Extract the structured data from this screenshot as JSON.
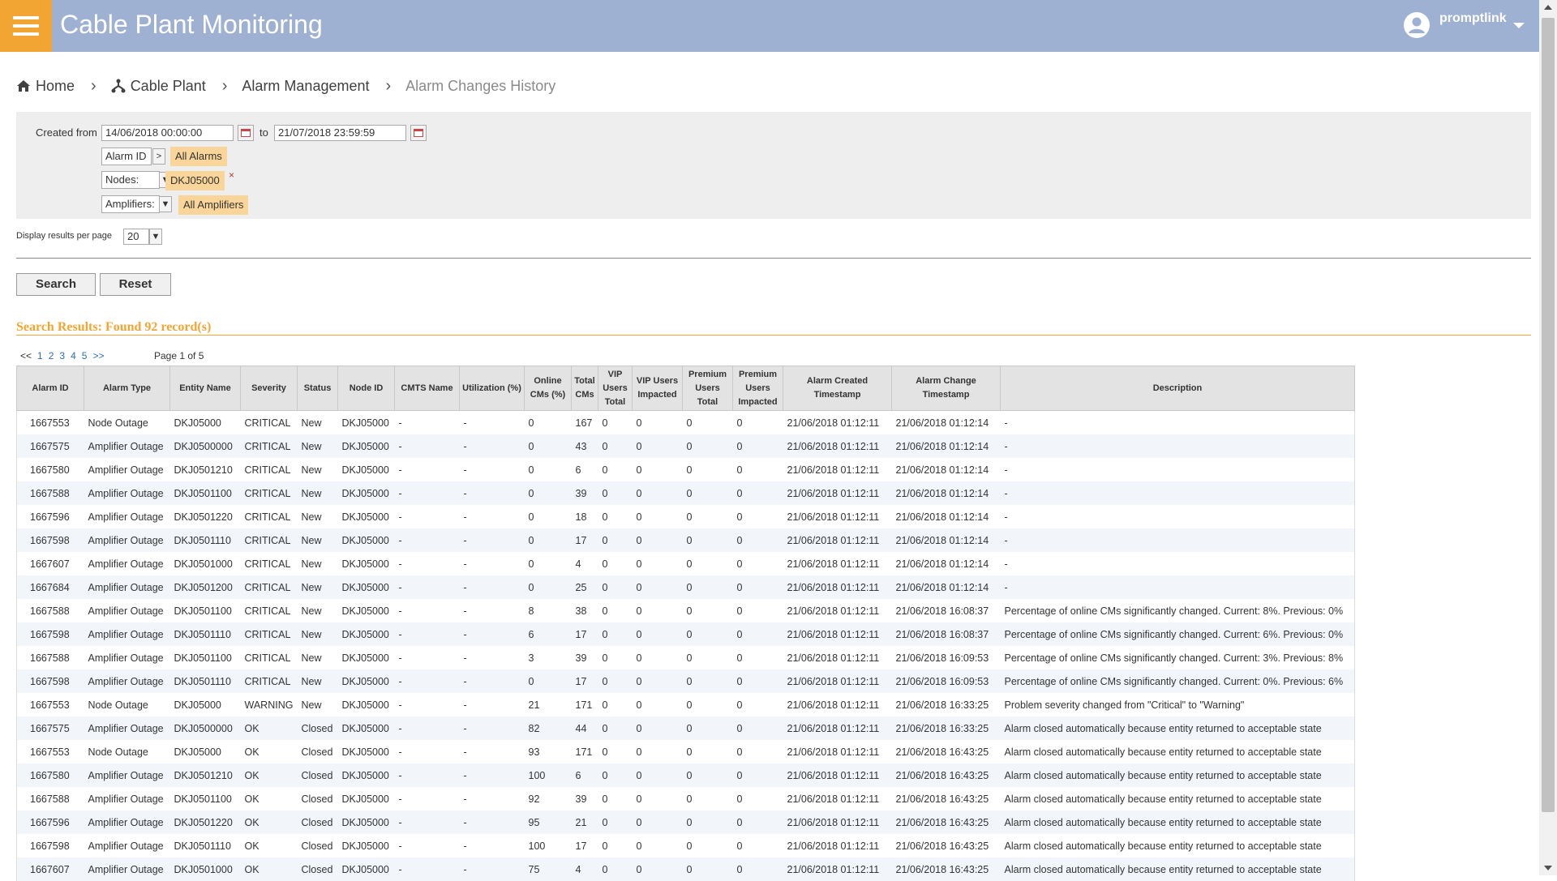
{
  "header": {
    "title": "Cable Plant Monitoring",
    "user": "promptlink"
  },
  "breadcrumb": [
    "Home",
    "Cable Plant",
    "Alarm Management",
    "Alarm Changes History"
  ],
  "filters": {
    "created_from_label": "Created from",
    "from_value": "14/06/2018 00:00:00",
    "to_label": "to",
    "to_value": "21/07/2018 23:59:59",
    "alarm_id_label": "Alarm ID",
    "alarm_id_arrow": ">",
    "alarm_id_tag": "All Alarms",
    "nodes_label": "Nodes:",
    "nodes_tag": "DKJ05000",
    "amplifiers_label": "Amplifiers:",
    "amplifiers_tag": "All Amplifiers",
    "dropdown_arrow": "▼",
    "remove_glyph": "×"
  },
  "per_page": {
    "label": "Display results per page",
    "value": "20"
  },
  "buttons": {
    "search": "Search",
    "reset": "Reset"
  },
  "results": {
    "title": "Search Results: Found 92 record(s)"
  },
  "pager": {
    "first": "<<",
    "pages": [
      "1",
      "2",
      "3",
      "4",
      "5"
    ],
    "last": ">>",
    "info": "Page 1 of 5"
  },
  "colors": {
    "header_bg": "#9fb1d3",
    "accent": "#f3a533",
    "critical": "#e53935",
    "warning": "#f3a533",
    "ok": "#43a047"
  },
  "icons": {
    "menu": "hamburger-icon",
    "user": "user-avatar-icon",
    "home": "home-icon",
    "cable_plant": "hierarchy-icon",
    "calendar": "calendar-icon"
  },
  "table": {
    "columns": [
      "Alarm ID",
      "Alarm Type",
      "Entity Name",
      "Severity",
      "Status",
      "Node ID",
      "CMTS Name",
      "Utilization (%)",
      "Online CMs (%)",
      "Total CMs",
      "VIP Users Total",
      "VIP Users Impacted",
      "Premium Users Total",
      "Premium Users Impacted",
      "Alarm Created Timestamp",
      "Alarm Change Timestamp",
      "Description"
    ],
    "rows": [
      [
        "1667553",
        "Node Outage",
        "DKJ05000",
        "CRITICAL",
        "New",
        "DKJ05000",
        "-",
        "-",
        "0",
        "167",
        "0",
        "0",
        "0",
        "0",
        "21/06/2018 01:12:11",
        "21/06/2018 01:12:14",
        "-"
      ],
      [
        "1667575",
        "Amplifier Outage",
        "DKJ0500000",
        "CRITICAL",
        "New",
        "DKJ05000",
        "-",
        "-",
        "0",
        "43",
        "0",
        "0",
        "0",
        "0",
        "21/06/2018 01:12:11",
        "21/06/2018 01:12:14",
        "-"
      ],
      [
        "1667580",
        "Amplifier Outage",
        "DKJ0501210",
        "CRITICAL",
        "New",
        "DKJ05000",
        "-",
        "-",
        "0",
        "6",
        "0",
        "0",
        "0",
        "0",
        "21/06/2018 01:12:11",
        "21/06/2018 01:12:14",
        "-"
      ],
      [
        "1667588",
        "Amplifier Outage",
        "DKJ0501100",
        "CRITICAL",
        "New",
        "DKJ05000",
        "-",
        "-",
        "0",
        "39",
        "0",
        "0",
        "0",
        "0",
        "21/06/2018 01:12:11",
        "21/06/2018 01:12:14",
        "-"
      ],
      [
        "1667596",
        "Amplifier Outage",
        "DKJ0501220",
        "CRITICAL",
        "New",
        "DKJ05000",
        "-",
        "-",
        "0",
        "18",
        "0",
        "0",
        "0",
        "0",
        "21/06/2018 01:12:11",
        "21/06/2018 01:12:14",
        "-"
      ],
      [
        "1667598",
        "Amplifier Outage",
        "DKJ0501110",
        "CRITICAL",
        "New",
        "DKJ05000",
        "-",
        "-",
        "0",
        "17",
        "0",
        "0",
        "0",
        "0",
        "21/06/2018 01:12:11",
        "21/06/2018 01:12:14",
        "-"
      ],
      [
        "1667607",
        "Amplifier Outage",
        "DKJ0501000",
        "CRITICAL",
        "New",
        "DKJ05000",
        "-",
        "-",
        "0",
        "4",
        "0",
        "0",
        "0",
        "0",
        "21/06/2018 01:12:11",
        "21/06/2018 01:12:14",
        "-"
      ],
      [
        "1667684",
        "Amplifier Outage",
        "DKJ0501200",
        "CRITICAL",
        "New",
        "DKJ05000",
        "-",
        "-",
        "0",
        "25",
        "0",
        "0",
        "0",
        "0",
        "21/06/2018 01:12:11",
        "21/06/2018 01:12:14",
        "-"
      ],
      [
        "1667588",
        "Amplifier Outage",
        "DKJ0501100",
        "CRITICAL",
        "New",
        "DKJ05000",
        "-",
        "-",
        "8",
        "38",
        "0",
        "0",
        "0",
        "0",
        "21/06/2018 01:12:11",
        "21/06/2018 16:08:37",
        "Percentage of online CMs significantly changed. Current: 8%. Previous: 0%"
      ],
      [
        "1667598",
        "Amplifier Outage",
        "DKJ0501110",
        "CRITICAL",
        "New",
        "DKJ05000",
        "-",
        "-",
        "6",
        "17",
        "0",
        "0",
        "0",
        "0",
        "21/06/2018 01:12:11",
        "21/06/2018 16:08:37",
        "Percentage of online CMs significantly changed. Current: 6%. Previous: 0%"
      ],
      [
        "1667588",
        "Amplifier Outage",
        "DKJ0501100",
        "CRITICAL",
        "New",
        "DKJ05000",
        "-",
        "-",
        "3",
        "39",
        "0",
        "0",
        "0",
        "0",
        "21/06/2018 01:12:11",
        "21/06/2018 16:09:53",
        "Percentage of online CMs significantly changed. Current: 3%. Previous: 8%"
      ],
      [
        "1667598",
        "Amplifier Outage",
        "DKJ0501110",
        "CRITICAL",
        "New",
        "DKJ05000",
        "-",
        "-",
        "0",
        "17",
        "0",
        "0",
        "0",
        "0",
        "21/06/2018 01:12:11",
        "21/06/2018 16:09:53",
        "Percentage of online CMs significantly changed. Current: 0%. Previous: 6%"
      ],
      [
        "1667553",
        "Node Outage",
        "DKJ05000",
        "WARNING",
        "New",
        "DKJ05000",
        "-",
        "-",
        "21",
        "171",
        "0",
        "0",
        "0",
        "0",
        "21/06/2018 01:12:11",
        "21/06/2018 16:33:25",
        "Problem severity changed from \"Critical\" to \"Warning\""
      ],
      [
        "1667575",
        "Amplifier Outage",
        "DKJ0500000",
        "OK",
        "Closed",
        "DKJ05000",
        "-",
        "-",
        "82",
        "44",
        "0",
        "0",
        "0",
        "0",
        "21/06/2018 01:12:11",
        "21/06/2018 16:33:25",
        "Alarm closed automatically because entity returned to acceptable state"
      ],
      [
        "1667553",
        "Node Outage",
        "DKJ05000",
        "OK",
        "Closed",
        "DKJ05000",
        "-",
        "-",
        "93",
        "171",
        "0",
        "0",
        "0",
        "0",
        "21/06/2018 01:12:11",
        "21/06/2018 16:43:25",
        "Alarm closed automatically because entity returned to acceptable state"
      ],
      [
        "1667580",
        "Amplifier Outage",
        "DKJ0501210",
        "OK",
        "Closed",
        "DKJ05000",
        "-",
        "-",
        "100",
        "6",
        "0",
        "0",
        "0",
        "0",
        "21/06/2018 01:12:11",
        "21/06/2018 16:43:25",
        "Alarm closed automatically because entity returned to acceptable state"
      ],
      [
        "1667588",
        "Amplifier Outage",
        "DKJ0501100",
        "OK",
        "Closed",
        "DKJ05000",
        "-",
        "-",
        "92",
        "39",
        "0",
        "0",
        "0",
        "0",
        "21/06/2018 01:12:11",
        "21/06/2018 16:43:25",
        "Alarm closed automatically because entity returned to acceptable state"
      ],
      [
        "1667596",
        "Amplifier Outage",
        "DKJ0501220",
        "OK",
        "Closed",
        "DKJ05000",
        "-",
        "-",
        "95",
        "21",
        "0",
        "0",
        "0",
        "0",
        "21/06/2018 01:12:11",
        "21/06/2018 16:43:25",
        "Alarm closed automatically because entity returned to acceptable state"
      ],
      [
        "1667598",
        "Amplifier Outage",
        "DKJ0501110",
        "OK",
        "Closed",
        "DKJ05000",
        "-",
        "-",
        "100",
        "17",
        "0",
        "0",
        "0",
        "0",
        "21/06/2018 01:12:11",
        "21/06/2018 16:43:25",
        "Alarm closed automatically because entity returned to acceptable state"
      ],
      [
        "1667607",
        "Amplifier Outage",
        "DKJ0501000",
        "OK",
        "Closed",
        "DKJ05000",
        "-",
        "-",
        "75",
        "4",
        "0",
        "0",
        "0",
        "0",
        "21/06/2018 01:12:11",
        "21/06/2018 16:43:25",
        "Alarm closed automatically because entity returned to acceptable state"
      ]
    ]
  }
}
